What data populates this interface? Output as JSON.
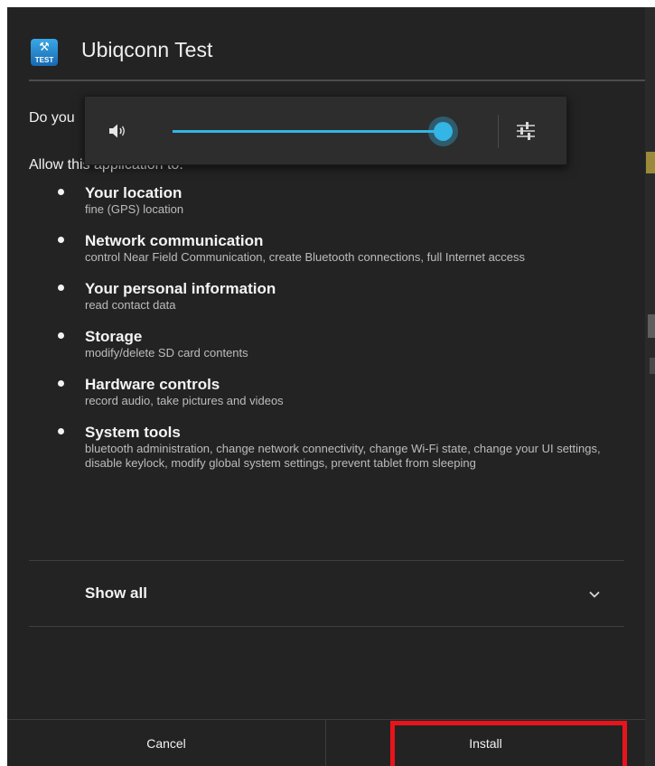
{
  "dialog": {
    "app_title": "Ubiqconn Test",
    "app_icon_label": "TEST",
    "question": "Do you",
    "allow_text": "Allow this application to:"
  },
  "permissions": [
    {
      "title": "Your location",
      "desc": "fine (GPS) location"
    },
    {
      "title": "Network communication",
      "desc": "control Near Field Communication, create Bluetooth connections, full Internet access"
    },
    {
      "title": "Your personal information",
      "desc": "read contact data"
    },
    {
      "title": "Storage",
      "desc": "modify/delete SD card contents"
    },
    {
      "title": "Hardware controls",
      "desc": "record audio, take pictures and videos"
    },
    {
      "title": "System tools",
      "desc": "bluetooth administration, change network connectivity, change Wi-Fi state, change your UI settings, disable keylock, modify global system settings, prevent tablet from sleeping"
    }
  ],
  "show_all": {
    "label": "Show all"
  },
  "buttons": {
    "cancel": "Cancel",
    "install": "Install"
  },
  "volume_popup": {
    "level": 0.97
  },
  "colors": {
    "dialog_bg": "#232323",
    "accent": "#33b5e5",
    "highlight": "#e8141b"
  }
}
